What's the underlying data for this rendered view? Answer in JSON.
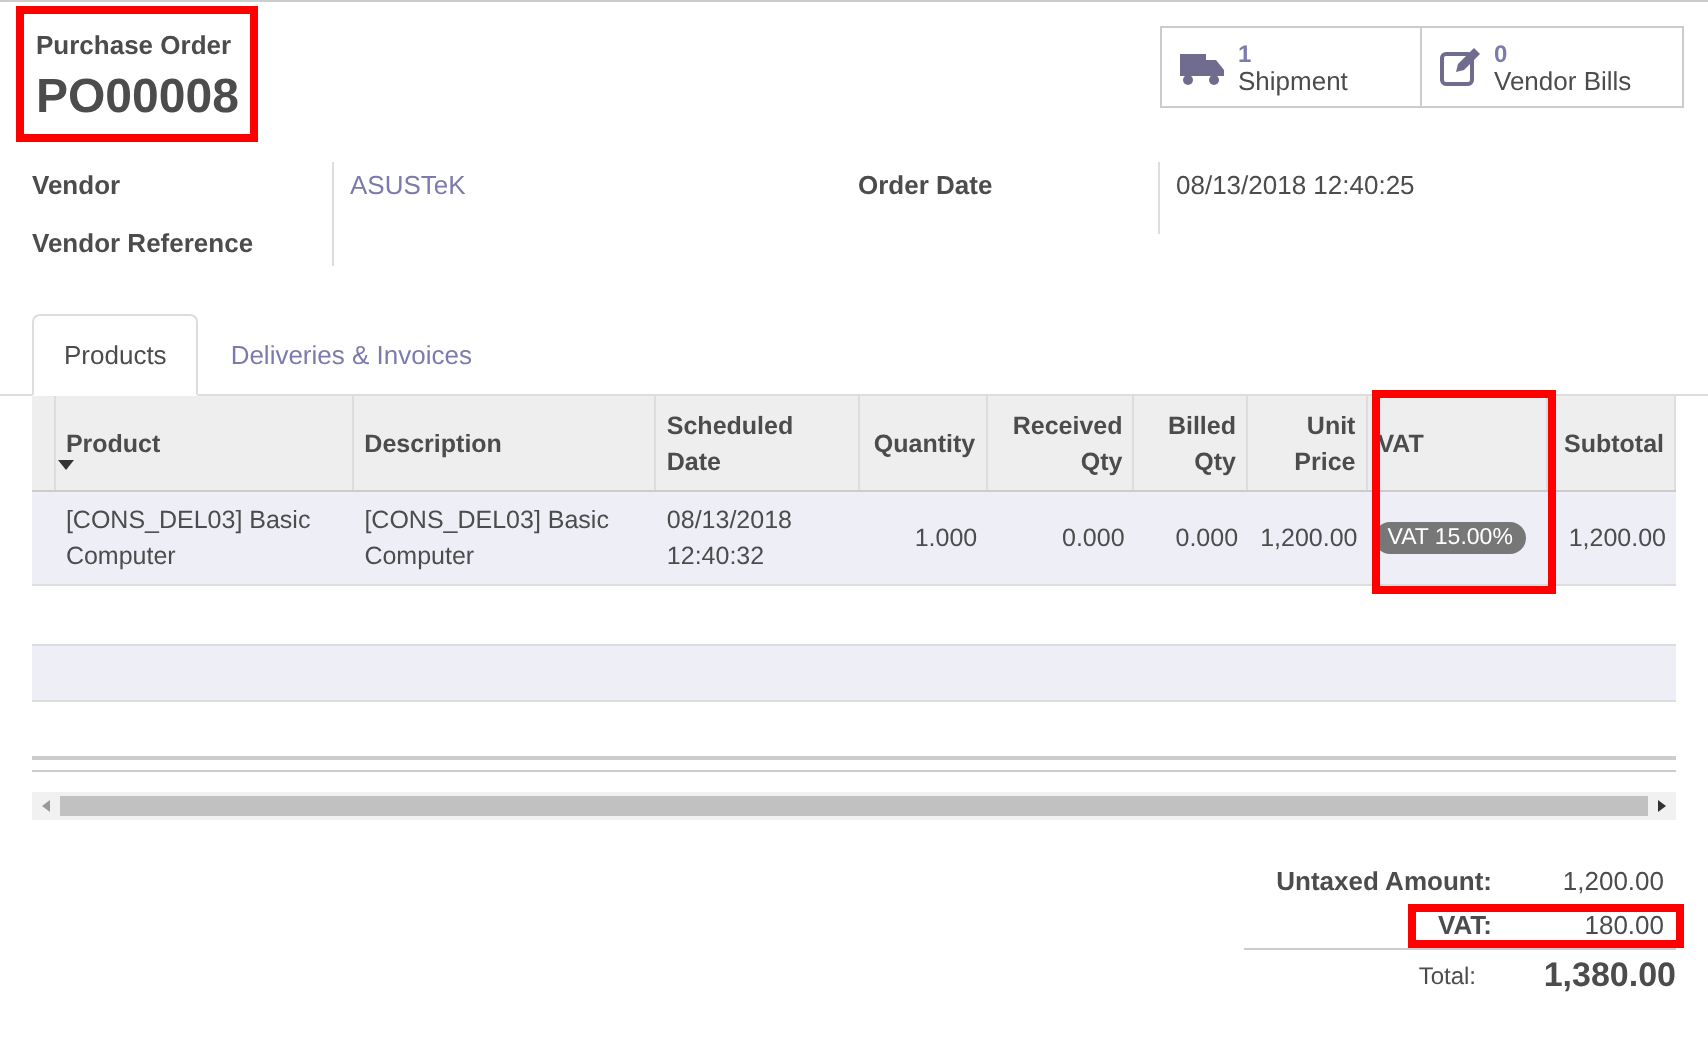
{
  "header": {
    "label": "Purchase Order",
    "number": "PO00008",
    "highlighted": true
  },
  "smart_buttons": [
    {
      "kind": "truck",
      "count": "1",
      "label": "Shipment"
    },
    {
      "kind": "edit",
      "count": "0",
      "label": "Vendor Bills"
    }
  ],
  "fields_left": [
    {
      "label": "Vendor",
      "value": "ASUSTeK",
      "kind": "link"
    },
    {
      "label": "Vendor Reference"
    }
  ],
  "fields_right": [
    {
      "label": "Order Date",
      "value": "08/13/2018 12:40:25"
    }
  ],
  "tabs": [
    {
      "label": "Products",
      "selected": true
    },
    {
      "label": "Deliveries & Invoices",
      "selected": false
    }
  ],
  "table": {
    "columns": [
      {
        "label": "Product",
        "sorted": true
      },
      {
        "label": "Description",
        "sorted": false
      },
      {
        "label": "Scheduled Date",
        "sorted": false
      },
      {
        "label": "Quantity",
        "sorted": false
      },
      {
        "label": "Received Qty",
        "sorted": false
      },
      {
        "label": "Billed Qty",
        "sorted": false
      },
      {
        "label": "Unit Price",
        "sorted": false
      },
      {
        "label": "VAT",
        "sorted": false,
        "highlighted": true
      },
      {
        "label": "Subtotal",
        "sorted": false
      }
    ],
    "rows": [
      {
        "cells": [
          "[CONS_DEL03] Basic Computer",
          "[CONS_DEL03] Basic Computer",
          "08/13/2018 12:40:32",
          "1.000",
          "0.000",
          "0.000",
          "1,200.00",
          {
            "tag": "VAT 15.00%"
          },
          "1,200.00"
        ]
      }
    ]
  },
  "totals": [
    {
      "label": "Untaxed Amount:",
      "value": "1,200.00",
      "kind": "line"
    },
    {
      "label": "VAT:",
      "value": "180.00",
      "kind": "line",
      "highlighted": true
    },
    {
      "label": "Total:",
      "value": "1,380.00",
      "kind": "total"
    }
  ]
}
